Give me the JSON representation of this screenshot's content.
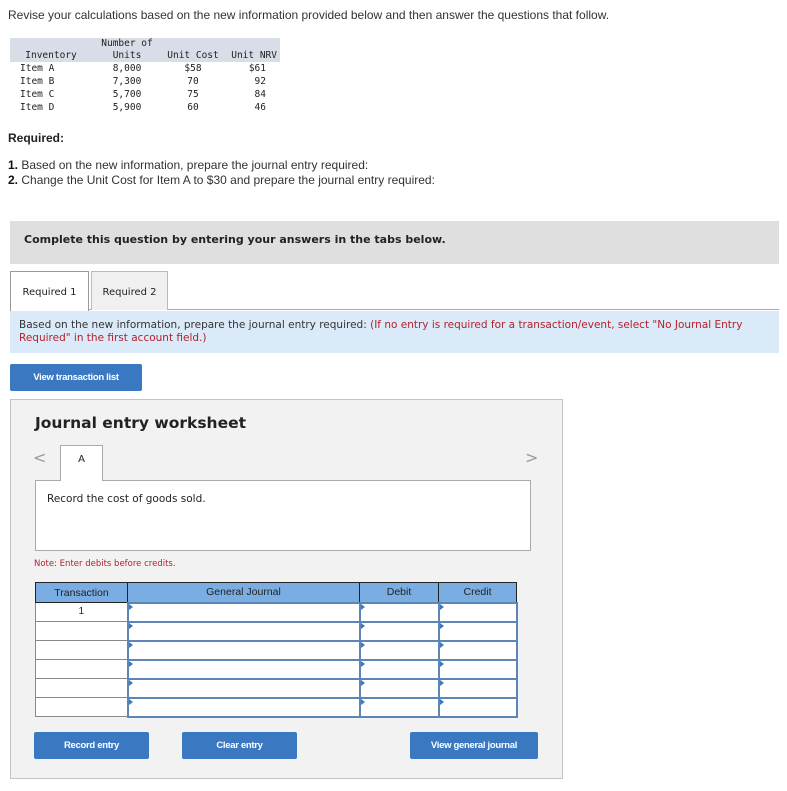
{
  "intro": "Revise your calculations based on the new information provided below and then answer the questions that follow.",
  "inventory_table": {
    "headers": {
      "inventory": "Inventory",
      "units_top": "Number of",
      "units": "Units",
      "unit_cost": "Unit Cost",
      "unit_nrv": "Unit NRV"
    },
    "rows": [
      {
        "item": "Item A",
        "units": "8,000",
        "cost": "$58",
        "nrv": "$61"
      },
      {
        "item": "Item B",
        "units": "7,300",
        "cost": "70",
        "nrv": "92"
      },
      {
        "item": "Item C",
        "units": "5,700",
        "cost": "75",
        "nrv": "84"
      },
      {
        "item": "Item D",
        "units": "5,900",
        "cost": "60",
        "nrv": "46"
      }
    ]
  },
  "required": {
    "title": "Required:",
    "items": [
      {
        "num": "1.",
        "text": "Based on the new information, prepare the journal entry required:"
      },
      {
        "num": "2.",
        "text": "Change the Unit Cost for Item A to $30 and prepare the journal entry required:"
      }
    ]
  },
  "banner": "Complete this question by entering your answers in the tabs below.",
  "tabs": [
    {
      "label": "Required 1",
      "active": true
    },
    {
      "label": "Required 2",
      "active": false
    }
  ],
  "instruction": {
    "main": "Based on the new information, prepare the journal entry required: ",
    "note": "(If no entry is required for a transaction/event, select \"No Journal Entry Required\" in the first account field.)"
  },
  "buttons": {
    "view_transaction_list": "View transaction list",
    "record_entry": "Record entry",
    "clear_entry": "Clear entry",
    "view_general_journal": "View general journal"
  },
  "worksheet": {
    "title": "Journal entry worksheet",
    "nav_prev": "<",
    "nav_next": ">",
    "current_tab": "A",
    "description": "Record the cost of goods sold.",
    "note": "Note: Enter debits before credits.",
    "columns": [
      "Transaction",
      "General Journal",
      "Debit",
      "Credit"
    ],
    "rows": [
      {
        "transaction": "1",
        "account": "",
        "debit": "",
        "credit": ""
      },
      {
        "transaction": "",
        "account": "",
        "debit": "",
        "credit": ""
      },
      {
        "transaction": "",
        "account": "",
        "debit": "",
        "credit": ""
      },
      {
        "transaction": "",
        "account": "",
        "debit": "",
        "credit": ""
      },
      {
        "transaction": "",
        "account": "",
        "debit": "",
        "credit": ""
      },
      {
        "transaction": "",
        "account": "",
        "debit": "",
        "credit": ""
      }
    ]
  }
}
